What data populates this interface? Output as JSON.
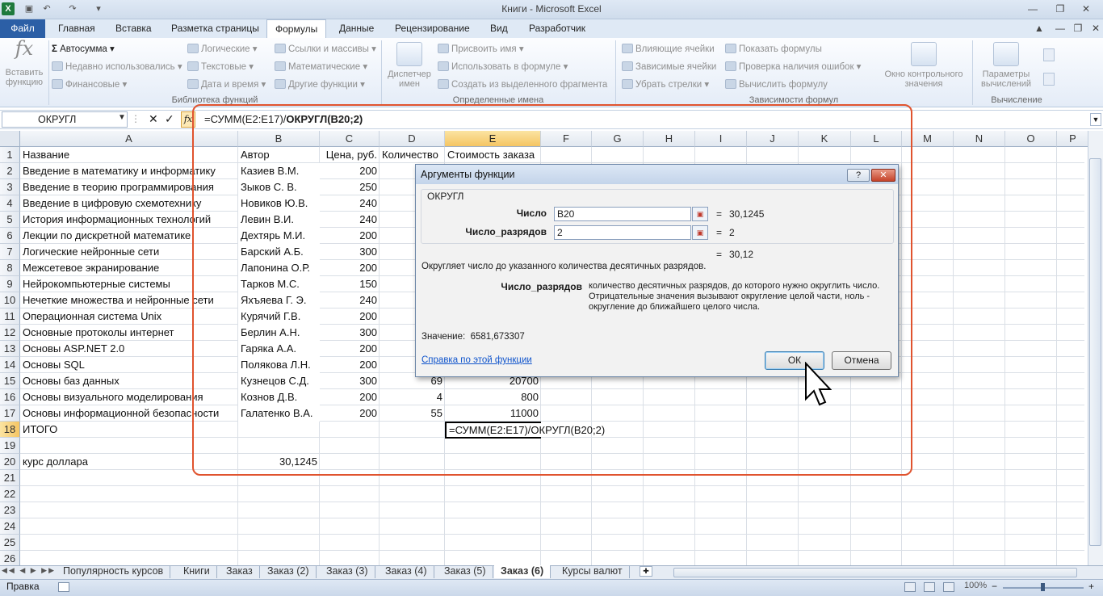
{
  "window": {
    "title": "Книги - Microsoft Excel"
  },
  "tabs": [
    "Файл",
    "Главная",
    "Вставка",
    "Разметка страницы",
    "Формулы",
    "Данные",
    "Рецензирование",
    "Вид",
    "Разработчик"
  ],
  "ribbon": {
    "insert_function": "Вставить функцию",
    "library": {
      "autosum": "Автосумма",
      "recent": "Недавно использовались",
      "financial": "Финансовые",
      "logical": "Логические",
      "text": "Текстовые",
      "datetime": "Дата и время",
      "lookup": "Ссылки и массивы",
      "math": "Математические",
      "other": "Другие функции",
      "label": "Библиотека функций"
    },
    "names": {
      "manager": "Диспетчер имен",
      "define": "Присвоить имя",
      "use": "Использовать в формуле",
      "create": "Создать из выделенного фрагмента",
      "label": "Определенные имена"
    },
    "audit": {
      "precedents": "Влияющие ячейки",
      "dependents": "Зависимые ячейки",
      "remove": "Убрать стрелки",
      "show": "Показать формулы",
      "check": "Проверка наличия ошибок",
      "evaluate": "Вычислить формулу",
      "watch": "Окно контрольного значения",
      "label": "Зависимости формул"
    },
    "calc": {
      "options": "Параметры вычислений",
      "label": "Вычисление"
    }
  },
  "formula_bar": {
    "name_box": "ОКРУГЛ",
    "fx": "fx",
    "formula_plain": "=СУММ(E2:E17)/",
    "formula_bold": "ОКРУГЛ(B20;2)"
  },
  "columns": [
    "A",
    "B",
    "C",
    "D",
    "E",
    "F",
    "G",
    "H",
    "I",
    "J",
    "K",
    "L",
    "M",
    "N",
    "O",
    "P"
  ],
  "rows": [
    "1",
    "2",
    "3",
    "4",
    "5",
    "6",
    "7",
    "8",
    "9",
    "10",
    "11",
    "12",
    "13",
    "14",
    "15",
    "16",
    "17",
    "18",
    "19",
    "20",
    "21",
    "22",
    "23",
    "24",
    "25",
    "26"
  ],
  "sheet": {
    "headers": {
      "a": "Название",
      "b": "Автор",
      "c": "Цена, руб.",
      "d": "Количество",
      "e": "Стоимость заказа"
    },
    "data": [
      {
        "a": "Введение в математику и информатику",
        "b": "Казиев В.М.",
        "c": "200",
        "d": "",
        "e": ""
      },
      {
        "a": "Введение в теорию программирования",
        "b": "Зыков С. В.",
        "c": "250",
        "d": "",
        "e": ""
      },
      {
        "a": "Введение в цифровую схемотехнику",
        "b": "Новиков Ю.В.",
        "c": "240",
        "d": "",
        "e": ""
      },
      {
        "a": "История информационных технологий",
        "b": "Левин В.И.",
        "c": "240",
        "d": "",
        "e": ""
      },
      {
        "a": "Лекции по дискретной математике",
        "b": "Дехтярь М.И.",
        "c": "200",
        "d": "",
        "e": ""
      },
      {
        "a": "Логические нейронные сети",
        "b": "Барский А.Б.",
        "c": "300",
        "d": "",
        "e": ""
      },
      {
        "a": "Межсетевое экранирование",
        "b": "Лапонина О.Р.",
        "c": "200",
        "d": "",
        "e": ""
      },
      {
        "a": "Нейрокомпьютерные системы",
        "b": "Тарков М.С.",
        "c": "150",
        "d": "",
        "e": ""
      },
      {
        "a": "Нечеткие множества и нейронные сети",
        "b": "Яхъяева Г. Э.",
        "c": "240",
        "d": "",
        "e": ""
      },
      {
        "a": "Операционная система Unix",
        "b": "Курячий Г.В.",
        "c": "200",
        "d": "",
        "e": ""
      },
      {
        "a": "Основные протоколы интернет",
        "b": "Берлин А.Н.",
        "c": "300",
        "d": "",
        "e": ""
      },
      {
        "a": "Основы ASP.NET 2.0",
        "b": "Гаряка А.А.",
        "c": "200",
        "d": "",
        "e": ""
      },
      {
        "a": "Основы SQL",
        "b": "Полякова Л.Н.",
        "c": "200",
        "d": "",
        "e": ""
      },
      {
        "a": "Основы баз данных",
        "b": "Кузнецов С.Д.",
        "c": "300",
        "d": "69",
        "e": "20700"
      },
      {
        "a": "Основы визуального моделирования",
        "b": "Кознов Д.В.",
        "c": "200",
        "d": "4",
        "e": "800"
      },
      {
        "a": "Основы информационной безопасности",
        "b": "Галатенко В.А.",
        "c": "200",
        "d": "55",
        "e": "11000"
      }
    ],
    "total_label": "ИТОГО",
    "edit_formula": "=СУММ(E2:E17)/ОКРУГЛ(B20;2)",
    "rate_label": "курс доллара",
    "rate_value": "30,1245"
  },
  "dialog": {
    "title": "Аргументы функции",
    "fn": "ОКРУГЛ",
    "arg1_label": "Число",
    "arg1_value": "B20",
    "arg1_result": "30,1245",
    "arg2_label": "Число_разрядов",
    "arg2_value": "2",
    "arg2_result": "2",
    "eq": "=",
    "result": "30,12",
    "description": "Округляет число до указанного количества десятичных разрядов.",
    "arg_help_name": "Число_разрядов",
    "arg_help_line1": "количество десятичных разрядов, до которого нужно округлить число.",
    "arg_help_line2": "Отрицательные значения вызывают округление целой части, ноль -",
    "arg_help_line3": "округление до ближайшего целого числа.",
    "value_label": "Значение:",
    "value": "6581,673307",
    "help_link": "Справка по этой функции",
    "ok": "ОК",
    "cancel": "Отмена"
  },
  "sheet_tabs": [
    "Популярность курсов",
    "Книги",
    "Заказ",
    "Заказ (2)",
    "Заказ (3)",
    "Заказ (4)",
    "Заказ (5)",
    "Заказ (6)",
    "Курсы валют"
  ],
  "status": {
    "mode": "Правка",
    "zoom": "100%"
  }
}
